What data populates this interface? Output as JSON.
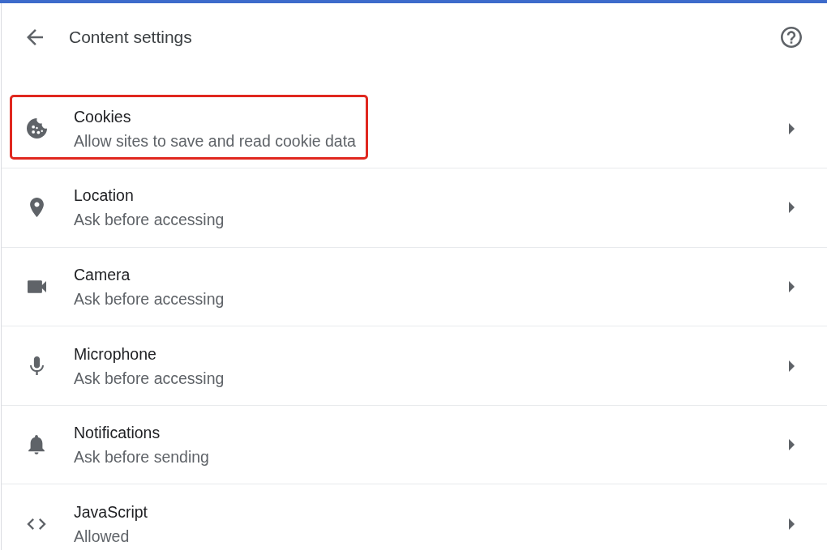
{
  "header": {
    "title": "Content settings"
  },
  "items": [
    {
      "kind": "cookies",
      "title": "Cookies",
      "subtitle": "Allow sites to save and read cookie data",
      "highlighted": true
    },
    {
      "kind": "location",
      "title": "Location",
      "subtitle": "Ask before accessing",
      "highlighted": false
    },
    {
      "kind": "camera",
      "title": "Camera",
      "subtitle": "Ask before accessing",
      "highlighted": false
    },
    {
      "kind": "microphone",
      "title": "Microphone",
      "subtitle": "Ask before accessing",
      "highlighted": false
    },
    {
      "kind": "notifications",
      "title": "Notifications",
      "subtitle": "Ask before sending",
      "highlighted": false
    },
    {
      "kind": "javascript",
      "title": "JavaScript",
      "subtitle": "Allowed",
      "highlighted": false
    }
  ]
}
